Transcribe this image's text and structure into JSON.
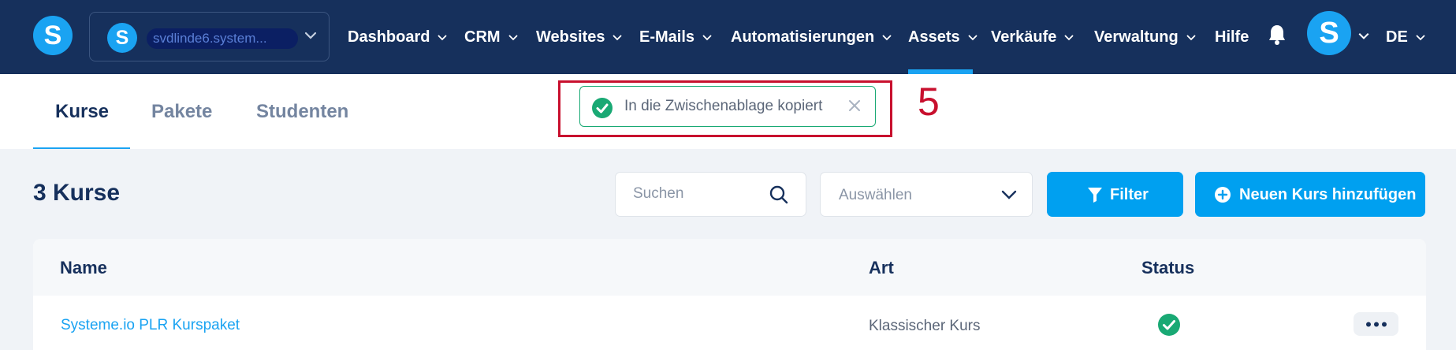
{
  "nav": {
    "logo_letter": "S",
    "workspace": {
      "logo_letter": "S",
      "name": "svdlinde6.system..."
    },
    "items": [
      {
        "label": "Dashboard"
      },
      {
        "label": "CRM"
      },
      {
        "label": "Websites"
      },
      {
        "label": "E-Mails"
      },
      {
        "label": "Automatisierungen"
      },
      {
        "label": "Assets",
        "active": true
      },
      {
        "label": "Verkäufe"
      },
      {
        "label": "Verwaltung"
      }
    ],
    "help_label": "Hilfe",
    "avatar_letter": "S",
    "language": "DE",
    "colors": {
      "background": "#16305c",
      "accent": "#1aa3f2"
    }
  },
  "tabs": [
    {
      "label": "Kurse",
      "active": true
    },
    {
      "label": "Pakete"
    },
    {
      "label": "Studenten"
    }
  ],
  "toast": {
    "message": "In die Zwischenablage kopiert",
    "status_color": "#19a974",
    "icons": {
      "status": "check-circle-icon",
      "close": "close-icon"
    }
  },
  "annotation": {
    "number": "5",
    "color": "#c8102e"
  },
  "toolbar": {
    "title": "3 Kurse",
    "search_placeholder": "Suchen",
    "select_placeholder": "Auswählen",
    "filter_label": "Filter",
    "add_label": "Neuen Kurs hinzufügen",
    "button_color": "#00a0f0"
  },
  "table": {
    "columns": {
      "name": "Name",
      "type": "Art",
      "status": "Status"
    },
    "rows": [
      {
        "name": "Systeme.io PLR Kurspaket",
        "type": "Klassischer Kurs",
        "status": "active"
      }
    ]
  }
}
